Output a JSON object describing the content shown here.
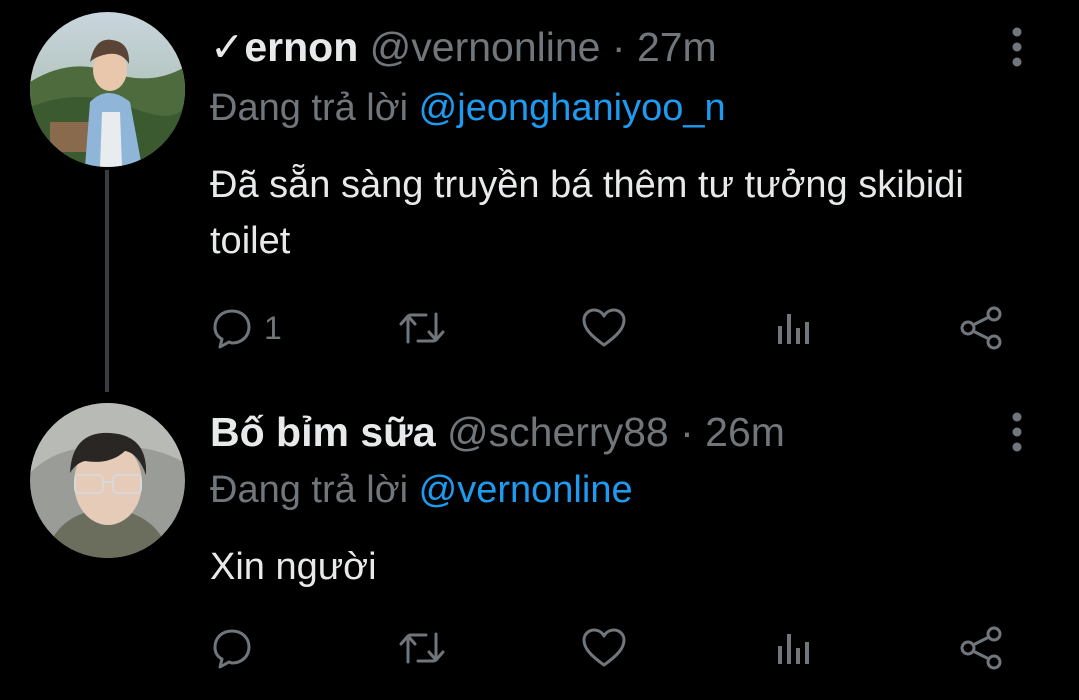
{
  "tweets": [
    {
      "name": "✓ernon",
      "handle": "@vernonline",
      "separator": "·",
      "time": "27m",
      "reply_prefix": "Đang trả lời",
      "reply_to": "@jeonghaniyoo_n",
      "text": "Đã sẵn sàng truyền bá thêm tư tưởng skibidi toilet",
      "reply_count": "1",
      "has_thread_line": true
    },
    {
      "name": "Bố bỉm sữa",
      "handle": "@scherry88",
      "separator": "·",
      "time": "26m",
      "reply_prefix": "Đang trả lời",
      "reply_to": "@vernonline",
      "text": "Xin người",
      "reply_count": "",
      "has_thread_line": false
    }
  ],
  "icons": {
    "reply": "speech-bubble-icon",
    "retweet": "retweet-icon",
    "like": "heart-icon",
    "stats": "bar-chart-icon",
    "share": "share-icon",
    "more": "vertical-dots-icon"
  },
  "colors": {
    "background": "#000000",
    "primary_text": "#e7e9ea",
    "secondary_text": "#71767b",
    "mention": "#1d9bf0",
    "thread_line": "#3a3d40"
  }
}
